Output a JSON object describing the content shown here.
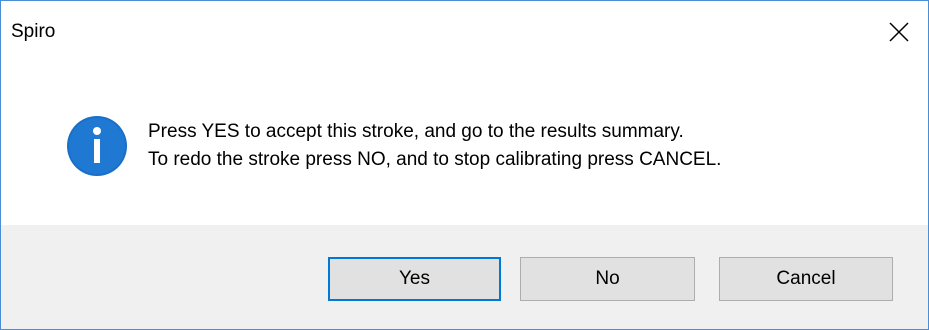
{
  "dialog": {
    "title": "Spiro",
    "close_icon": "close-icon",
    "info_icon": "info-icon",
    "message_line1": "Press YES to accept this stroke, and go to the results summary.",
    "message_line2": "To redo the stroke press NO, and to stop calibrating press CANCEL.",
    "accent_color": "#0078d7",
    "buttons": {
      "yes": "Yes",
      "no": "No",
      "cancel": "Cancel"
    },
    "default_button": "yes"
  }
}
